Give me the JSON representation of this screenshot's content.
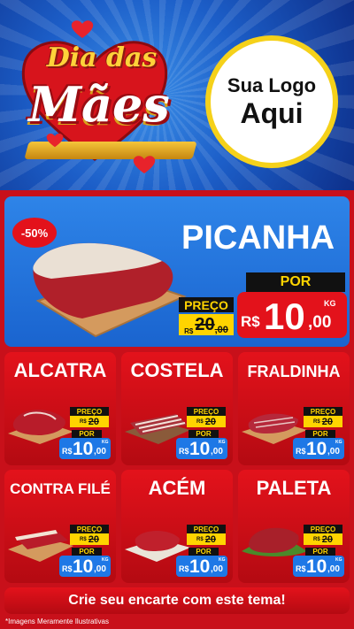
{
  "header": {
    "title_line1": "Dia das",
    "title_line2": "Mães",
    "logo_line1": "Sua Logo",
    "logo_line2": "Aqui"
  },
  "featured": {
    "discount": "-50%",
    "name": "PICANHA",
    "preco_label": "PREÇO",
    "old_currency": "R$",
    "old_price": "20",
    "old_cents": ",00",
    "por_label": "POR",
    "currency": "R$",
    "price": "10",
    "cents": ",00",
    "unit": "KG"
  },
  "products": [
    {
      "name": "ALCATRA",
      "preco_label": "PREÇO",
      "old_currency": "R$",
      "old_price": "20",
      "por_label": "POR",
      "currency": "R$",
      "price": "10",
      "cents": ",00",
      "unit": "KG"
    },
    {
      "name": "COSTELA",
      "preco_label": "PREÇO",
      "old_currency": "R$",
      "old_price": "20",
      "por_label": "POR",
      "currency": "R$",
      "price": "10",
      "cents": ",00",
      "unit": "KG"
    },
    {
      "name": "FRALDINHA",
      "preco_label": "PREÇO",
      "old_currency": "R$",
      "old_price": "20",
      "por_label": "POR",
      "currency": "R$",
      "price": "10",
      "cents": ",00",
      "unit": "KG"
    },
    {
      "name": "CONTRA FILÉ",
      "preco_label": "PREÇO",
      "old_currency": "R$",
      "old_price": "20",
      "por_label": "POR",
      "currency": "R$",
      "price": "10",
      "cents": ",00",
      "unit": "KG"
    },
    {
      "name": "ACÉM",
      "preco_label": "PREÇO",
      "old_currency": "R$",
      "old_price": "20",
      "por_label": "POR",
      "currency": "R$",
      "price": "10",
      "cents": ",00",
      "unit": "KG"
    },
    {
      "name": "PALETA",
      "preco_label": "PREÇO",
      "old_currency": "R$",
      "old_price": "20",
      "por_label": "POR",
      "currency": "R$",
      "price": "10",
      "cents": ",00",
      "unit": "KG"
    }
  ],
  "banner": "Crie seu encarte com este tema!",
  "footnote": "*Imagens Meramente Ilustrativas",
  "colors": {
    "red": "#e3121b",
    "blue": "#1e78e6",
    "yellow": "#ffd400",
    "dark": "#111111"
  }
}
